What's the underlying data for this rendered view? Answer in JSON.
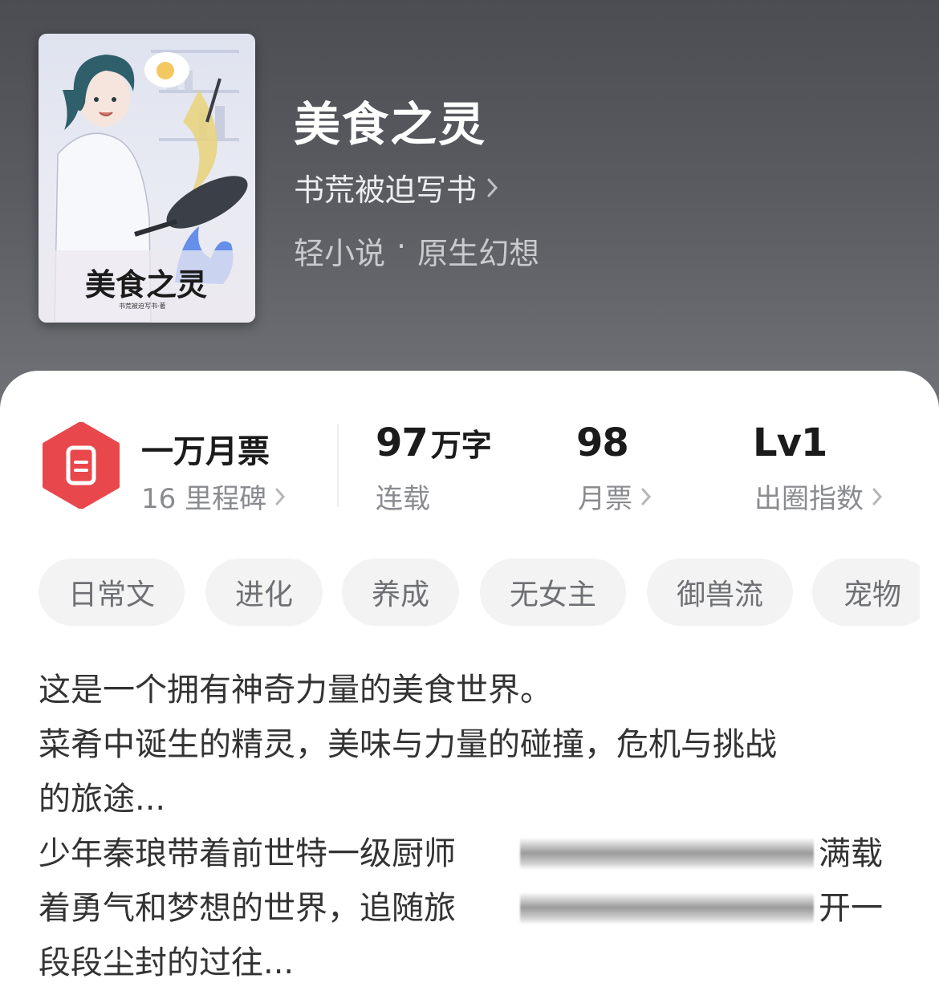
{
  "book": {
    "title": "美食之灵",
    "author": "书荒被迫写书",
    "category": "轻小说",
    "separator": "·",
    "subcategory": "原生幻想",
    "cover_title": "美食之灵",
    "cover_author": "书荒被迫写书·著"
  },
  "stats": {
    "badge_icon": "ticket-icon",
    "monthly_ticket_tier": "一万月票",
    "milestone": "16 里程碑",
    "word_count_num": "97",
    "word_count_unit": "万字",
    "status": "连载",
    "monthly_tickets": "98",
    "monthly_tickets_label": "月票",
    "level": "Lv1",
    "level_label": "出圈指数"
  },
  "tags": [
    "日常文",
    "进化",
    "养成",
    "无女主",
    "御兽流",
    "宠物"
  ],
  "synopsis": {
    "line1": "这是一个拥有神奇力量的美食世界。",
    "line2": "菜肴中诞生的精灵，美味与力量的碰撞，危机与挑战",
    "line3": "的旅途...",
    "line4_start": "少年秦琅带着前世特一级厨师",
    "line4_end": "满载",
    "line5_start": "着勇气和梦想的世界，追随旅",
    "line5_end": "开一",
    "line6": "段段尘封的过往..."
  },
  "colors": {
    "accent_red": "#e8474c",
    "header_top": "#4b4d53",
    "header_bottom": "#838488"
  }
}
